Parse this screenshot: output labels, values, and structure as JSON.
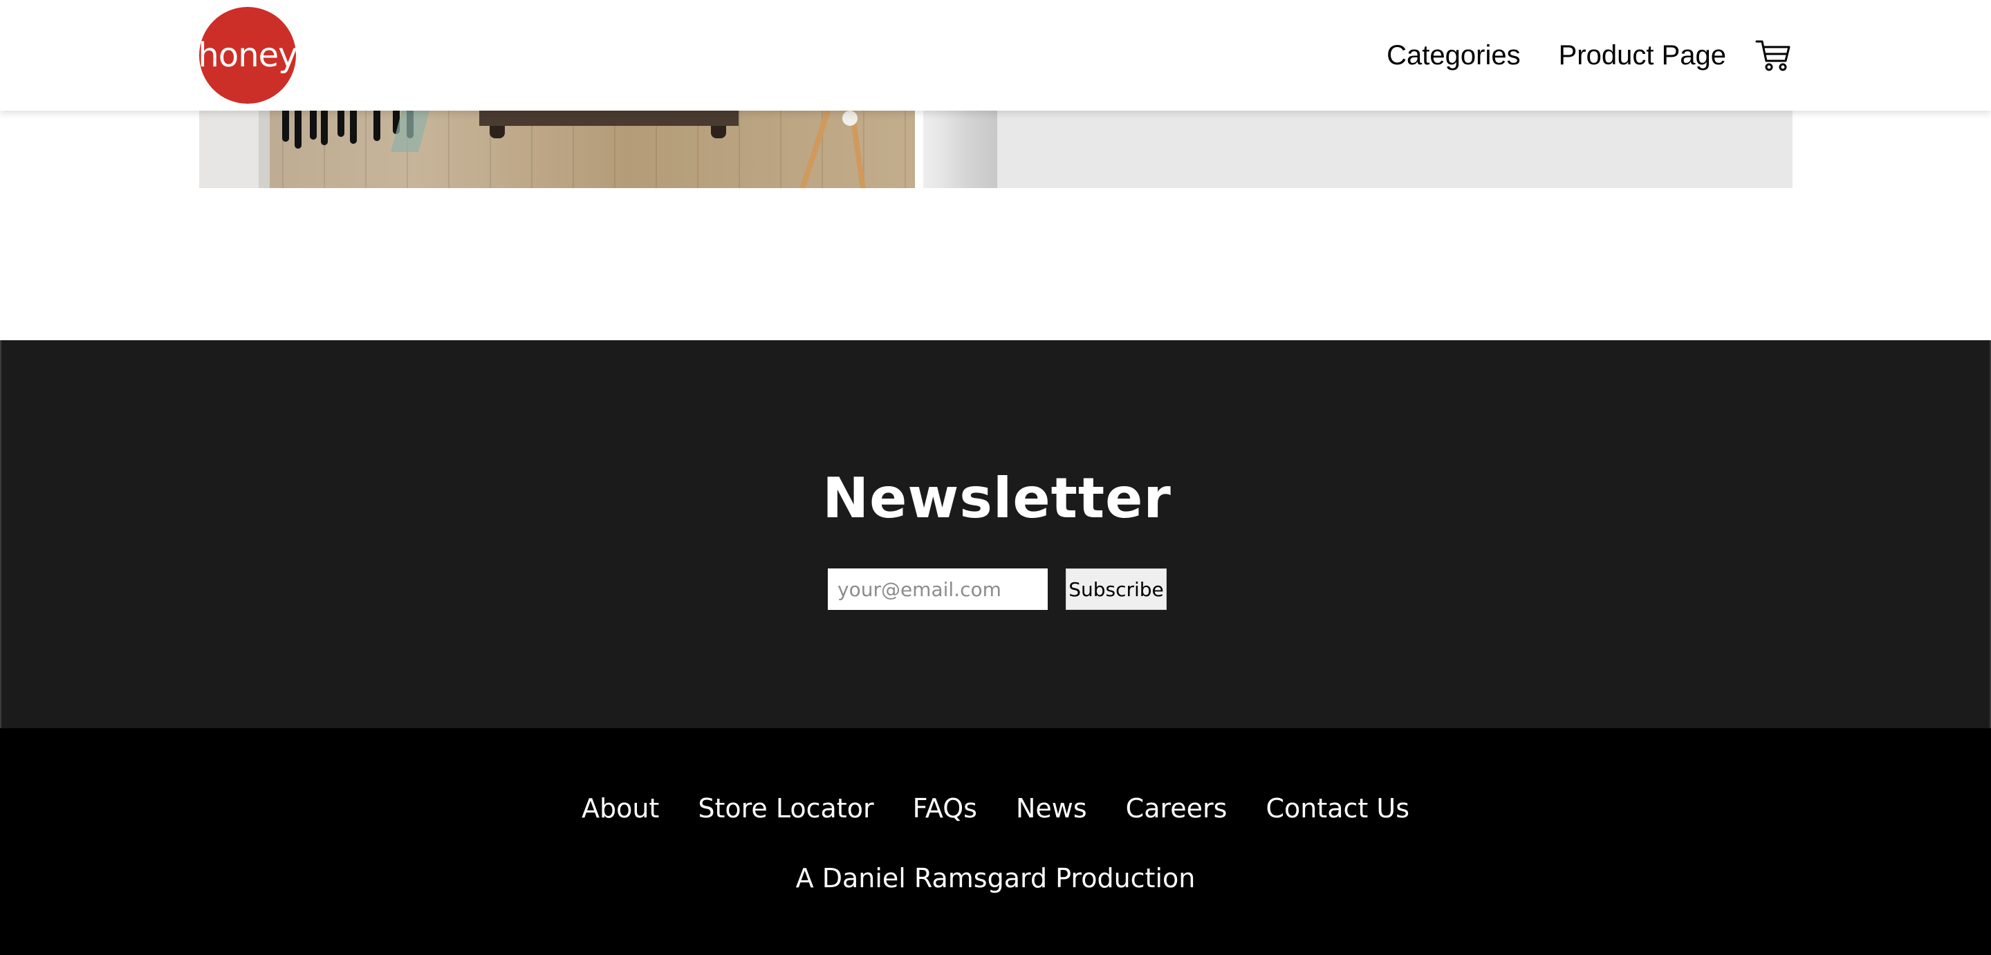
{
  "header": {
    "logo_text": "honey",
    "logo_color": "#cc2f27",
    "nav": [
      {
        "label": "Categories"
      },
      {
        "label": "Product Page"
      }
    ],
    "cart_icon": "shopping-cart-icon"
  },
  "newsletter": {
    "title": "Newsletter",
    "email_placeholder": "your@email.com",
    "subscribe_label": "Subscribe",
    "background": "#1b1b1b"
  },
  "footer": {
    "links": [
      {
        "label": "About"
      },
      {
        "label": "Store Locator"
      },
      {
        "label": "FAQs"
      },
      {
        "label": "News"
      },
      {
        "label": "Careers"
      },
      {
        "label": "Contact Us"
      }
    ],
    "credit": "A Daniel Ramsgard Production",
    "background": "#000000"
  }
}
